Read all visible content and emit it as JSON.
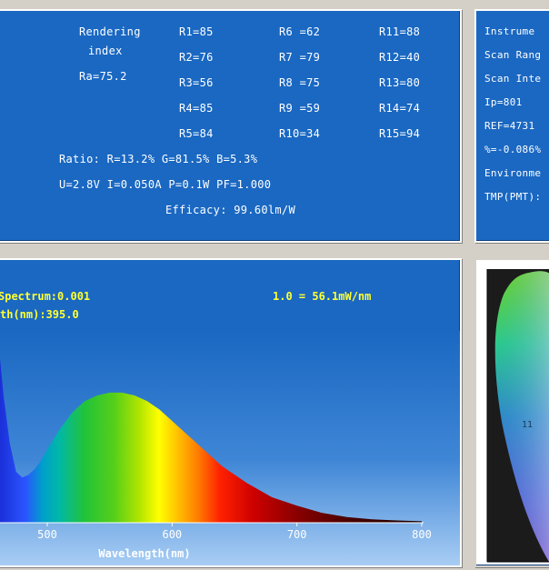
{
  "rendering": {
    "title_line1": "Rendering",
    "title_line2": "index",
    "ra": "Ra=75.2",
    "r_values": [
      "R1=85",
      "R2=76",
      "R3=56",
      "R4=85",
      "R5=84",
      "R6 =62",
      "R7 =79",
      "R8 =75",
      "R9 =59",
      "R10=34",
      "R11=88",
      "R12=40",
      "R13=80",
      "R14=74",
      "R15=94"
    ],
    "ratio": "Ratio: R=13.2% G=81.5% B=5.3%",
    "electrical": "U=2.8V I=0.050A P=0.1W PF=1.000",
    "efficacy": "Efficacy: 99.60lm/W"
  },
  "instrument": {
    "lines": [
      "Instrume",
      "Scan Rang",
      "Scan Inte",
      "Ip=801",
      "REF=4731",
      "%=-0.086%",
      "Environme",
      "TMP(PMT):"
    ]
  },
  "spectrum": {
    "info_left_1": " Spectrum:0.001",
    "info_left_2": "th(nm):395.0",
    "info_right": "1.0 = 56.1mW/nm",
    "xlabel": "Wavelength(nm)"
  },
  "chart_data": {
    "type": "area",
    "title": "",
    "xlabel": "Wavelength(nm)",
    "ylabel": "",
    "x_ticks": [
      500,
      600,
      700,
      800
    ],
    "xlim": [
      460,
      800
    ],
    "ylim": [
      0,
      1.0
    ],
    "x": [
      460,
      465,
      470,
      475,
      480,
      485,
      490,
      495,
      500,
      510,
      520,
      530,
      540,
      550,
      560,
      570,
      580,
      590,
      600,
      620,
      640,
      660,
      680,
      700,
      720,
      740,
      760,
      780,
      800
    ],
    "values": [
      0.7,
      0.45,
      0.28,
      0.18,
      0.16,
      0.17,
      0.19,
      0.22,
      0.26,
      0.33,
      0.39,
      0.43,
      0.45,
      0.46,
      0.46,
      0.45,
      0.43,
      0.4,
      0.36,
      0.28,
      0.2,
      0.14,
      0.09,
      0.06,
      0.035,
      0.02,
      0.012,
      0.008,
      0.005
    ]
  },
  "cie": {
    "label_cluster": "11"
  },
  "colors": {
    "panel_bg": "#1a68c2",
    "highlight_text": "#ffff33",
    "window_bg": "#d4d0c8"
  }
}
